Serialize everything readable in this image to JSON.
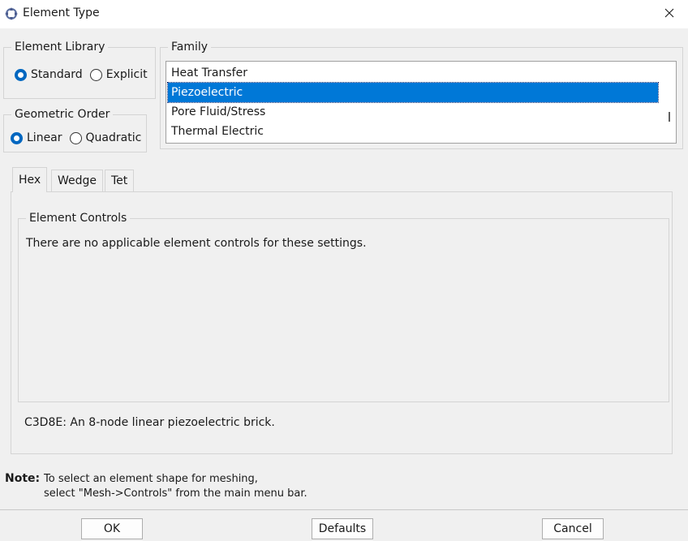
{
  "window": {
    "title": "Element Type",
    "icon": "crosshair-app-icon",
    "close_icon": "close-icon"
  },
  "element_library": {
    "legend": "Element Library",
    "options": [
      {
        "label": "Standard",
        "checked": true
      },
      {
        "label": "Explicit",
        "checked": false
      }
    ]
  },
  "geometric_order": {
    "legend": "Geometric Order",
    "options": [
      {
        "label": "Linear",
        "checked": true
      },
      {
        "label": "Quadratic",
        "checked": false
      }
    ]
  },
  "family": {
    "legend": "Family",
    "items": [
      "Heat Transfer",
      "Piezoelectric",
      "Pore Fluid/Stress",
      "Thermal Electric"
    ],
    "selected": "Piezoelectric"
  },
  "tabs": [
    {
      "label": "Hex",
      "active": true
    },
    {
      "label": "Wedge",
      "active": false
    },
    {
      "label": "Tet",
      "active": false
    }
  ],
  "element_controls": {
    "legend": "Element Controls",
    "message": "There are no applicable element controls for these settings."
  },
  "element_description": "C3D8E:  An 8-node linear piezoelectric brick.",
  "note": {
    "label": "Note:",
    "line1": "To select an element shape for meshing,",
    "line2": "select \"Mesh->Controls\" from the main menu bar."
  },
  "buttons": {
    "ok": "OK",
    "defaults": "Defaults",
    "cancel": "Cancel"
  },
  "colors": {
    "selection": "#0078d7",
    "radio_checked": "#0067c0",
    "dialog_bg": "#f0f0f0"
  }
}
